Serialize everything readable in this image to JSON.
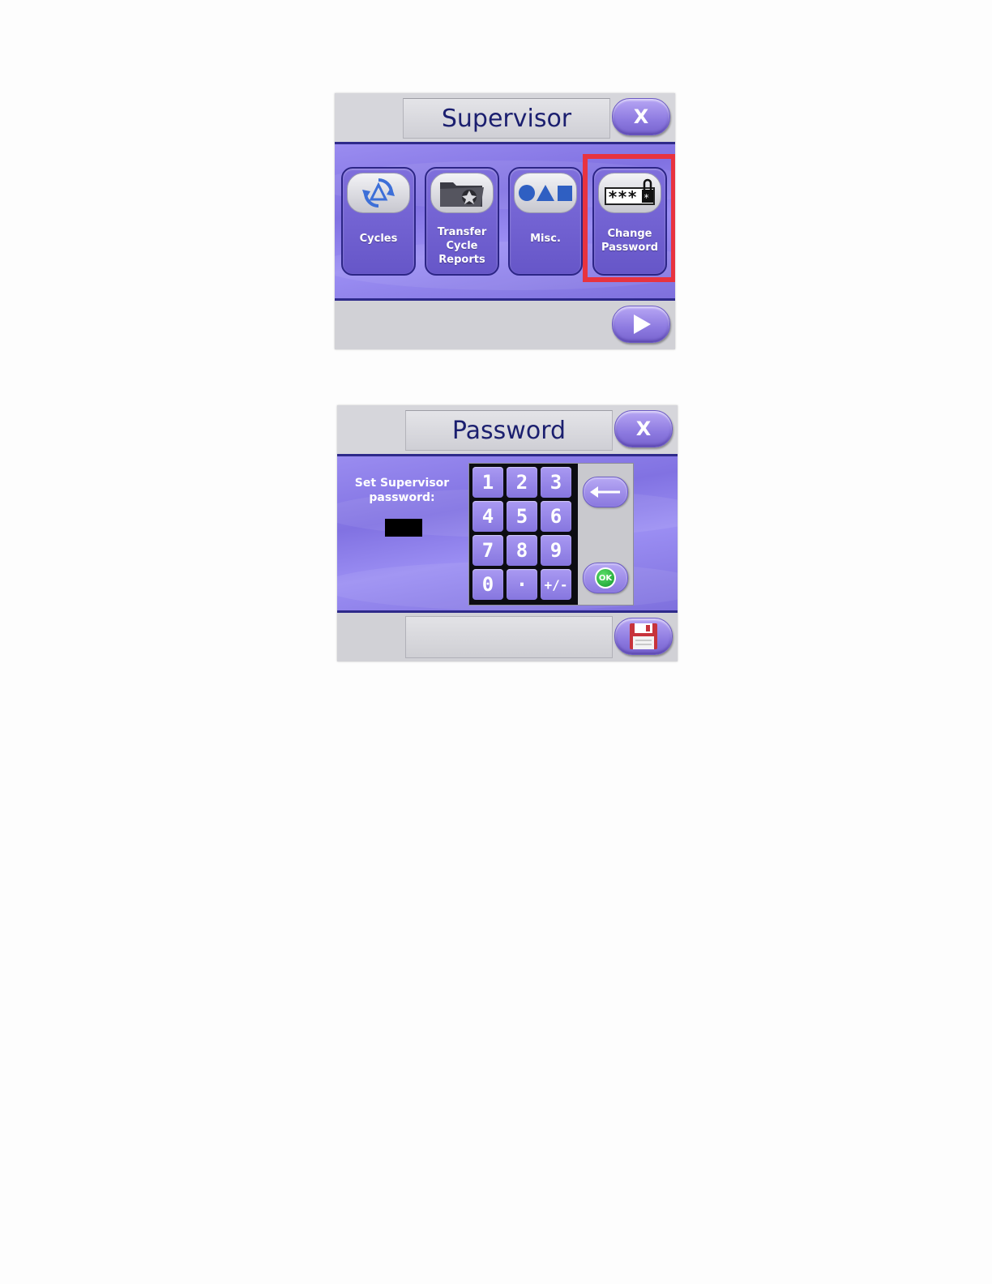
{
  "supervisor": {
    "title": "Supervisor",
    "close_label": "X",
    "tiles": [
      {
        "label_lines": [
          "Cycles"
        ],
        "icon": "cycle-arrows-icon"
      },
      {
        "label_lines": [
          "Transfer",
          "Cycle",
          "Reports"
        ],
        "icon": "folder-transfer-icon"
      },
      {
        "label_lines": [
          "Misc."
        ],
        "icon": "shapes-icon"
      },
      {
        "label_lines": [
          "Change",
          "Password"
        ],
        "icon": "password-lock-icon"
      }
    ],
    "next_icon": "play-arrow-icon",
    "highlight_color": "#e8333f"
  },
  "password": {
    "title": "Password",
    "close_label": "X",
    "prompt_lines": [
      "Set Supervisor",
      "password:"
    ],
    "keys": [
      "1",
      "2",
      "3",
      "4",
      "5",
      "6",
      "7",
      "8",
      "9",
      "0",
      "·",
      "+/-"
    ],
    "backspace_icon": "backspace-arrow-icon",
    "ok_label": "OK",
    "save_icon": "floppy-disk-icon"
  }
}
